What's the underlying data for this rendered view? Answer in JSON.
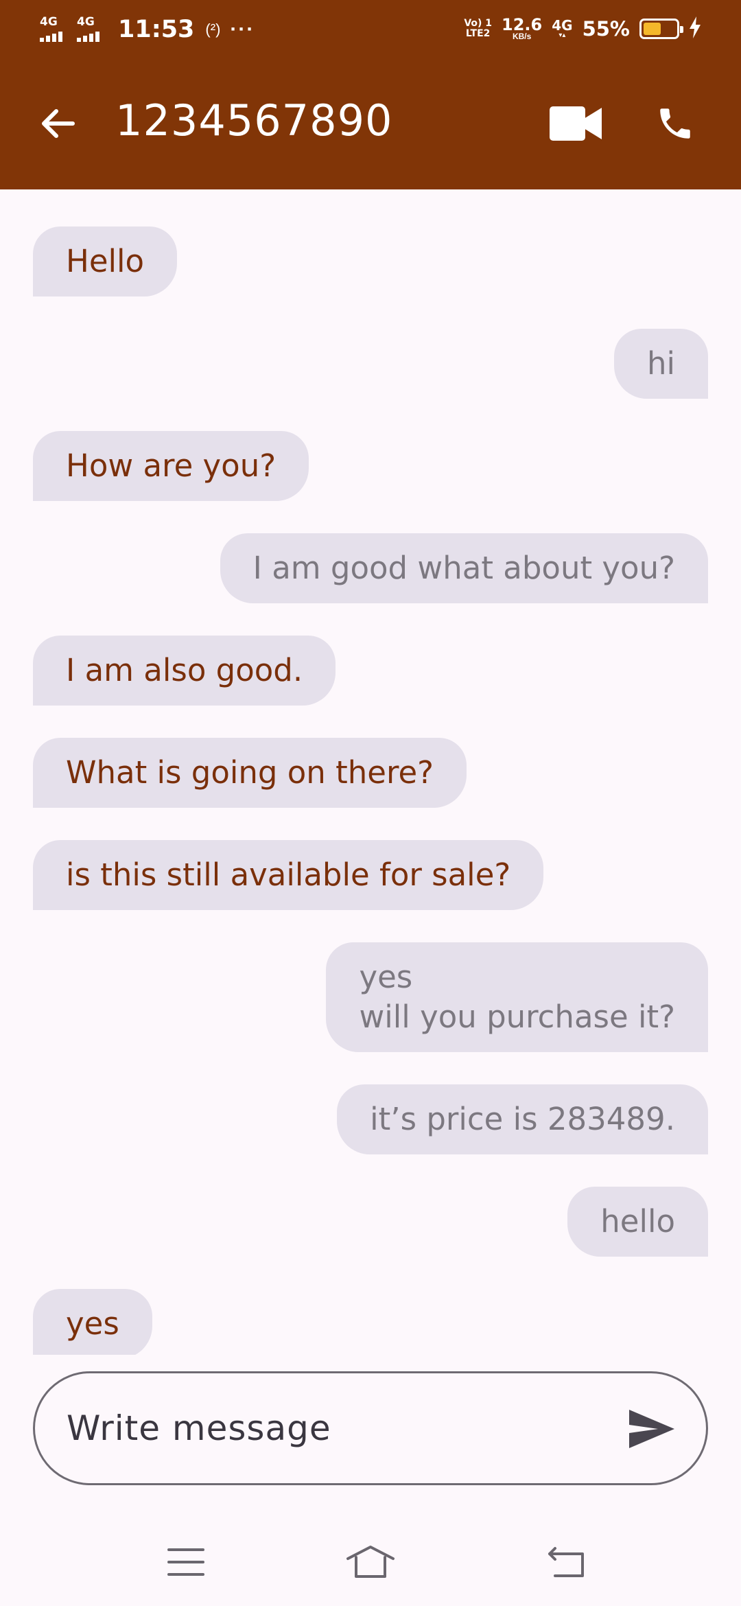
{
  "status_bar": {
    "network_1": "4G",
    "network_2": "4G",
    "time": "11:53",
    "hotspot": "(²)",
    "more": "···",
    "volte": "Vo) 1\nLTE2",
    "speed_value": "12.6",
    "speed_unit": "KB/s",
    "data_network": "4G",
    "battery_percent": "55%",
    "battery_level": 0.55
  },
  "app_bar": {
    "title": "1234567890",
    "back_icon": "arrow-back-icon",
    "video_icon": "videocam-icon",
    "call_icon": "phone-icon"
  },
  "messages": [
    {
      "direction": "in",
      "text": "Hello"
    },
    {
      "direction": "out",
      "text": "hi"
    },
    {
      "direction": "in",
      "text": "How are you?"
    },
    {
      "direction": "out",
      "text": "I am good what about you?"
    },
    {
      "direction": "in",
      "text": "I am also good."
    },
    {
      "direction": "in",
      "text": "What is going on there?"
    },
    {
      "direction": "in",
      "text": "is this still available for sale?"
    },
    {
      "direction": "out",
      "text": "yes\nwill you purchase it?"
    },
    {
      "direction": "out",
      "text": "it’s price is 283489."
    },
    {
      "direction": "out",
      "text": "hello"
    },
    {
      "direction": "in",
      "text": "yes"
    }
  ],
  "composer": {
    "placeholder": "Write message",
    "value": "",
    "send_icon": "send-icon"
  },
  "nav_bar": {
    "menu_icon": "menu-icon",
    "home_icon": "home-icon",
    "back_icon": "back-icon"
  },
  "colors": {
    "app_bar": "#813507",
    "bubble": "#e5e0eb",
    "incoming_text": "#7a2f0a",
    "outgoing_text": "#7c7880",
    "background": "#fdf8fc"
  }
}
